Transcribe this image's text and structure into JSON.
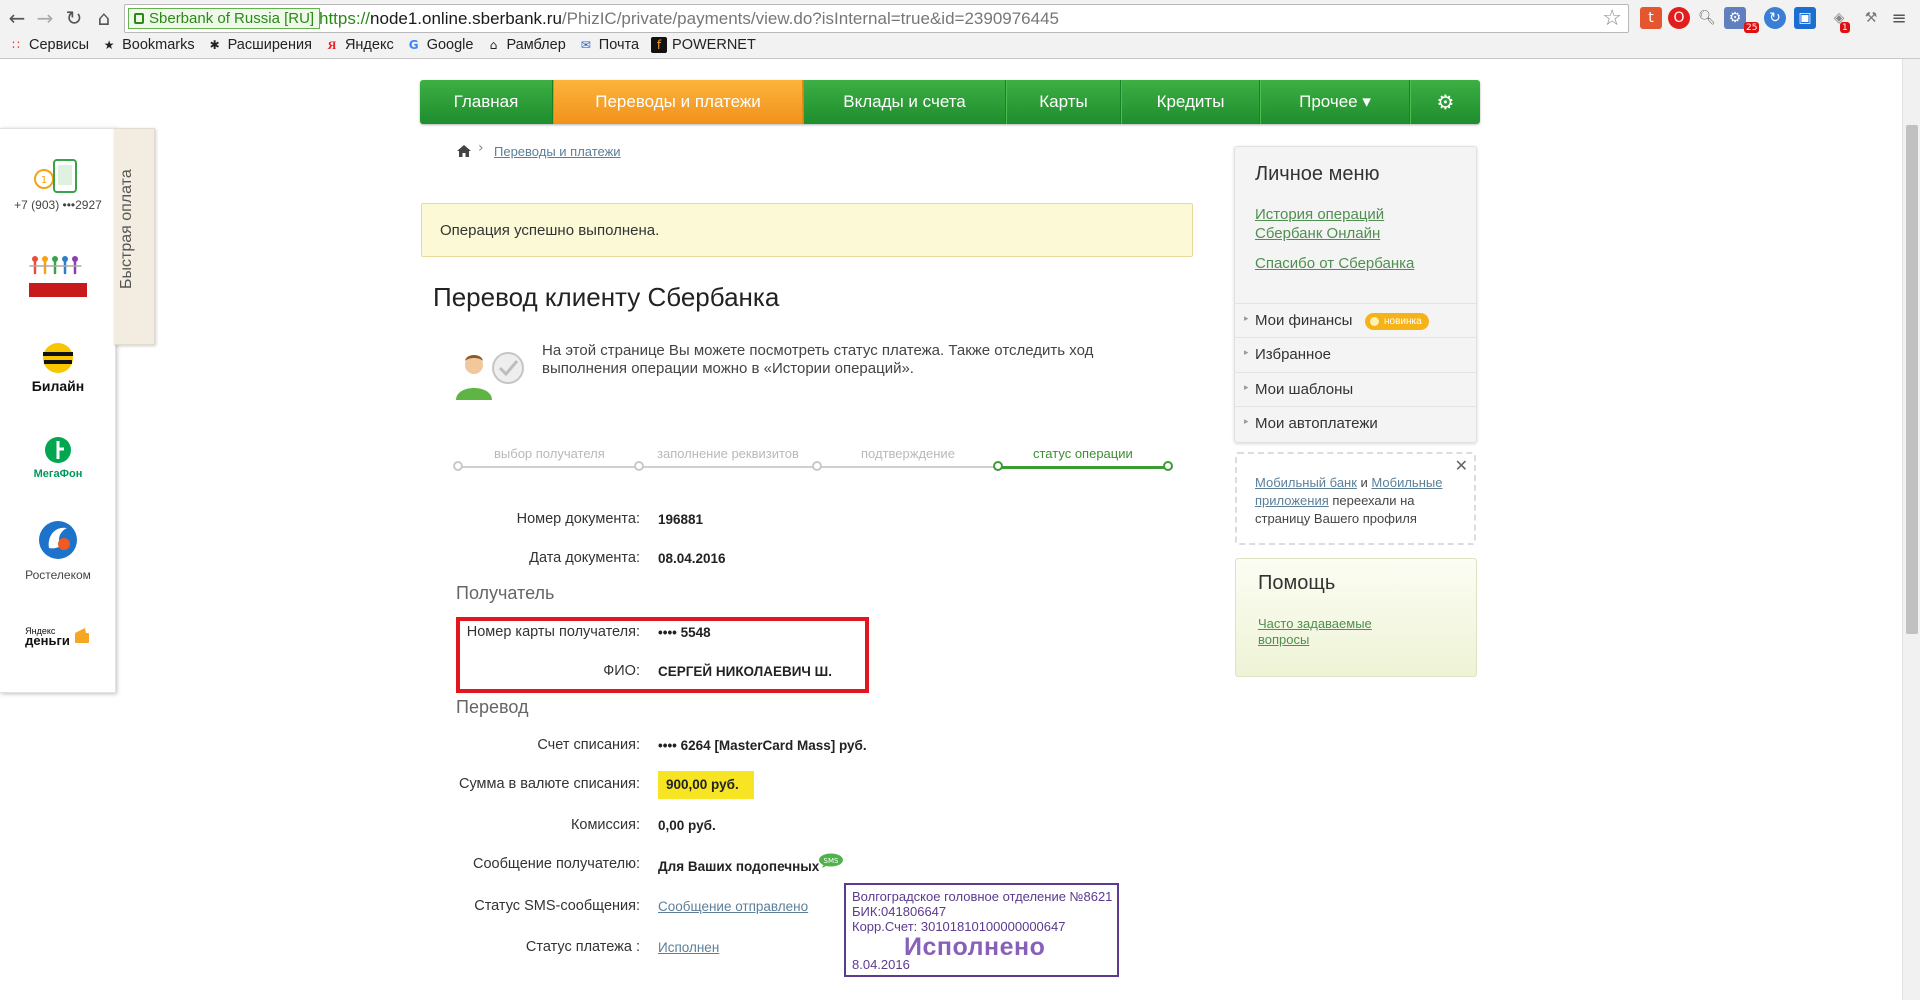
{
  "browser": {
    "ev_label": "Sberbank of Russia [RU]",
    "url_scheme": "https://",
    "url_host": "node1.online.sberbank.ru",
    "url_rest": "/PhizIC/private/payments/view.do?isInternal=true&id=2390976445",
    "ext_badges": [
      "25",
      "1"
    ],
    "bookmarks": [
      "Сервисы",
      "Bookmarks",
      "Расширения",
      "Яндекс",
      "Google",
      "Рамблер",
      "Почта",
      "POWERNET"
    ]
  },
  "topnav": {
    "items": [
      "Главная",
      "Переводы и платежи",
      "Вклады и счета",
      "Карты",
      "Кредиты",
      "Прочее ▾"
    ],
    "active_index": 1
  },
  "quickpay": {
    "tab_label": "Быстрая оплата",
    "phone": "+7 (903) •••2927",
    "items": [
      "Билайн",
      "МегаФон",
      "Ростелеком",
      "Яндекс",
      "деньги"
    ]
  },
  "breadcrumb": {
    "link": "Переводы и платежи"
  },
  "alert": {
    "text": "Операция успешно выполнена."
  },
  "page": {
    "title": "Перевод клиенту Сбербанка",
    "intro": "На этой странице Вы можете посмотреть статус платежа. Также отследить ход выполнения операции можно в «Истории операций»."
  },
  "steps": [
    "выбор получателя",
    "заполнение реквизитов",
    "подтверждение",
    "статус операции"
  ],
  "details": {
    "doc_number_label": "Номер документа:",
    "doc_number": "196881",
    "doc_date_label": "Дата документа:",
    "doc_date": "08.04.2016",
    "recipient_section": "Получатель",
    "card_label": "Номер карты получателя:",
    "card_value": "•••• 5548",
    "fio_label": "ФИО:",
    "fio_value": "СЕРГЕЙ НИКОЛАЕВИЧ Ш.",
    "transfer_section": "Перевод",
    "account_label": "Счет списания:",
    "account_value": "•••• 6264  [MasterCard Mass]  руб.",
    "amount_label": "Сумма в валюте списания:",
    "amount_value": "900,00  руб.",
    "commission_label": "Комиссия:",
    "commission_value": "0,00 руб.",
    "message_label": "Сообщение получателю:",
    "message_value": "Для Ваших подопечных",
    "sms_badge": "SMS",
    "sms_status_label": "Статус SMS-сообщения:",
    "sms_status_value": "Сообщение отправлено",
    "payment_status_label": "Статус платежа :",
    "payment_status_value": "Исполнен"
  },
  "stamp": {
    "line1": "Волгоградское головное отделение №8621",
    "line2": "БИК:041806647",
    "line3": "Корр.Счет: 30101810100000000647",
    "big": "Исполнено",
    "date": "8.04.2016"
  },
  "menu": {
    "title": "Личное меню",
    "link1": "История операций Сбербанк Онлайн",
    "link2": "Спасибо от Сбербанка",
    "rows": [
      "Мои финансы",
      "Избранное",
      "Мои шаблоны",
      "Мои автоплатежи"
    ],
    "badge_new": "новинка"
  },
  "notice": {
    "link1": "Мобильный банк",
    "and": " и ",
    "link2": "Мобильные приложения",
    "rest": " переехали на страницу Вашего профиля",
    "close": "✕"
  },
  "help": {
    "title": "Помощь",
    "link": "Часто задаваемые вопросы"
  },
  "colors": {
    "brand_green": "#1e8d2e",
    "active_orange": "#f2911c",
    "alert_yellow": "#fcf9d7",
    "highlight_red": "#e2161f",
    "stamp_purple": "#5b3a8f",
    "amount_yellow": "#f7e524"
  },
  "icons": [
    "back-arrow-icon",
    "forward-arrow-icon",
    "reload-icon",
    "home-icon",
    "star-icon",
    "gear-icon",
    "chevron-down-icon",
    "check-shield-icon",
    "close-icon"
  ]
}
